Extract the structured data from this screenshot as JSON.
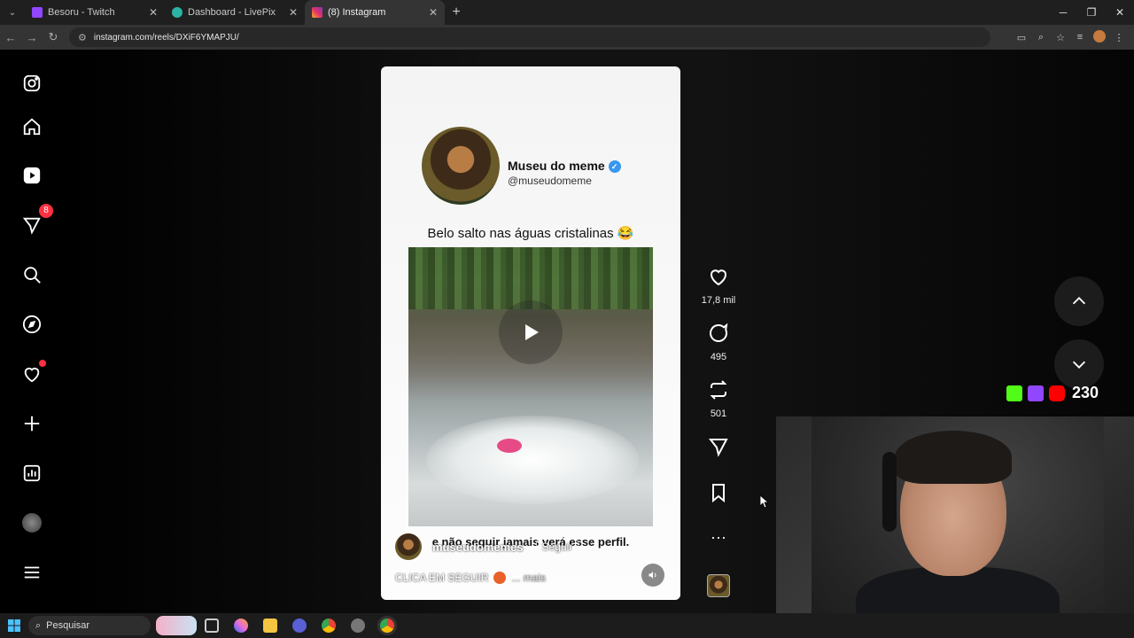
{
  "browser": {
    "tabs": [
      {
        "title": "Besoru - Twitch",
        "color": "#9146ff",
        "active": false
      },
      {
        "title": "Dashboard - LivePix",
        "color": "#2bb3a3",
        "active": false
      },
      {
        "title": "(8) Instagram",
        "color": "#e1306c",
        "active": true
      }
    ],
    "url": "instagram.com/reels/DXiF6YMAPJU/"
  },
  "sidebar": {
    "notifications_badge": "8",
    "items": [
      "instagram-logo-icon",
      "home-icon",
      "reels-icon",
      "messages-icon",
      "search-icon",
      "explore-icon",
      "notifications-icon",
      "create-icon",
      "dashboard-icon",
      "profile-avatar",
      "more-menu-icon"
    ]
  },
  "reel": {
    "account_name": "Museu do meme",
    "account_handle": "@museudomeme",
    "title": "Belo salto nas águas cristalinas 😂",
    "subtitle_overlay": "e não seguir jamais verá esse perfil.",
    "owner_name": "museudomemes",
    "follow_label": "Seguir",
    "caption": "CLICA EM SEGUIR",
    "more_label": "... mais"
  },
  "actions": {
    "likes": "17,8 mil",
    "comments": "495",
    "reposts": "501"
  },
  "overlay": {
    "viewer_count": "230"
  },
  "taskbar": {
    "search_placeholder": "Pesquisar"
  }
}
